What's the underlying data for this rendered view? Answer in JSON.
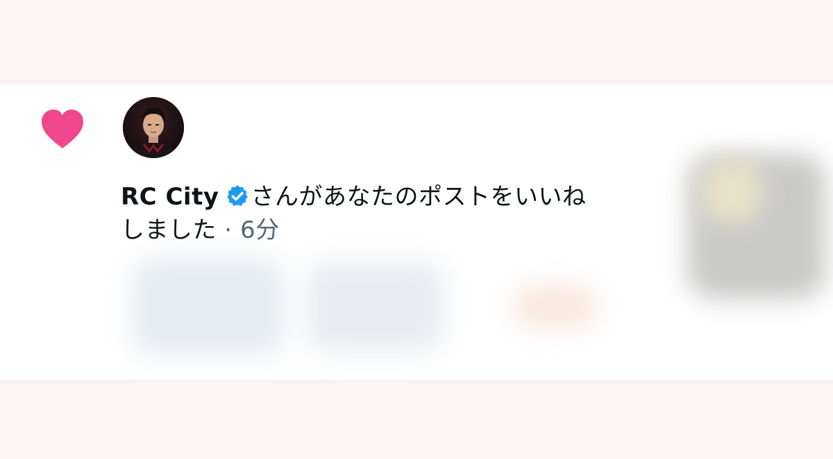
{
  "notification": {
    "type_icon": "heart-icon",
    "username": "RC City",
    "verified_icon": "verified-badge-icon",
    "action_text": "さんがあなたのポストをいいね",
    "action_text_line2": "しました",
    "separator": " · ",
    "time": "6分"
  },
  "colors": {
    "heart": "#f0468c",
    "verified": "#1d9bf0",
    "text_primary": "#0f1419",
    "text_secondary": "#536471",
    "card_bg": "#ffffff",
    "outer_bg": "#fcf3f4"
  }
}
